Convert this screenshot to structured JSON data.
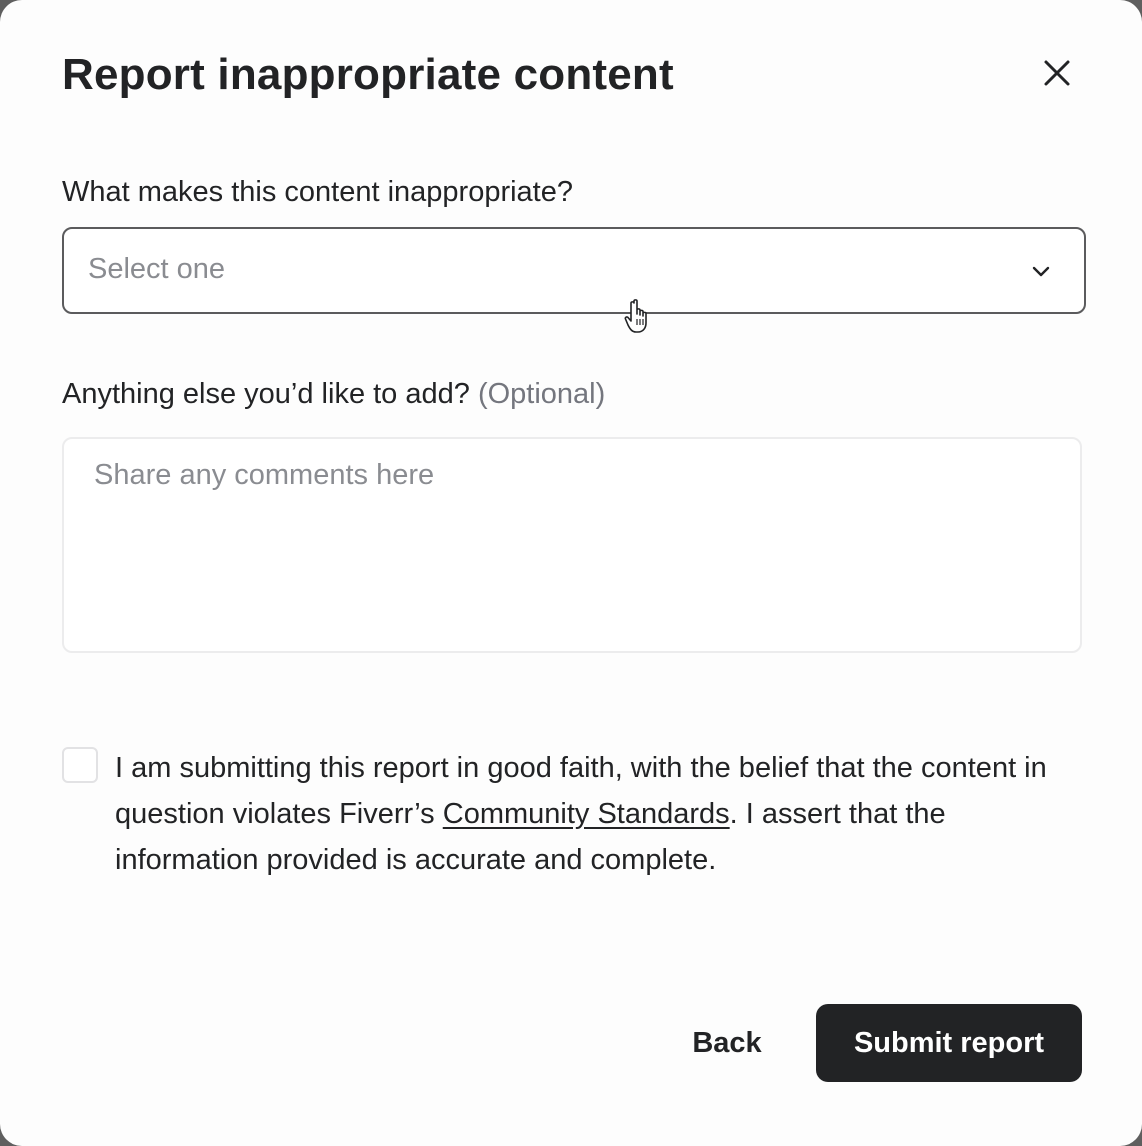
{
  "dialog": {
    "title": "Report inappropriate content",
    "close_icon": "close-icon"
  },
  "reason": {
    "label": "What makes this content inappropriate?",
    "placeholder": "Select one",
    "chevron_icon": "chevron-down-icon"
  },
  "comments": {
    "label": "Anything else you’d like to add?",
    "optional_tag": "(Optional)",
    "placeholder": "Share any comments here",
    "value": ""
  },
  "consent": {
    "checked": false,
    "text_before": "I am submitting this report in good faith, with the belief that the content in question violates Fiverr’s ",
    "link_text": "Community Standards",
    "text_after": ". I assert that the information provided is accurate and complete."
  },
  "actions": {
    "back_label": "Back",
    "submit_label": "Submit report"
  },
  "colors": {
    "text": "#222325",
    "muted": "#74767e",
    "primary_button": "#222325",
    "primary_button_text": "#ffffff",
    "select_border": "#5b5b5d",
    "textarea_border": "#ececed"
  }
}
